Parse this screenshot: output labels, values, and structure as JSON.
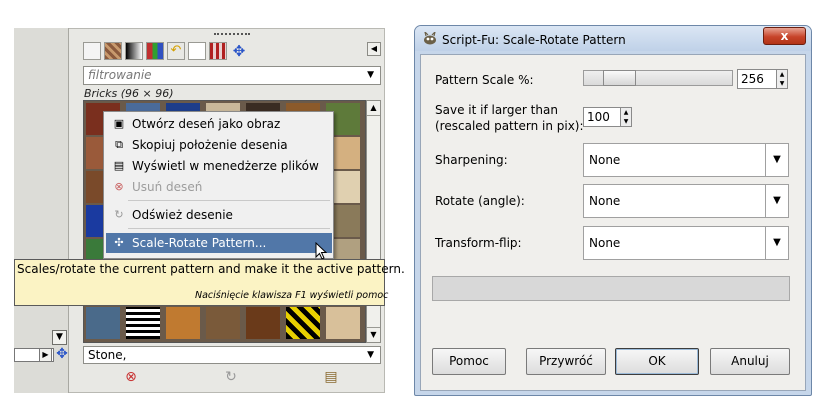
{
  "gimp_dock": {
    "filter_placeholder": "filtrowanie",
    "pattern_label": "Bricks (96 × 96)",
    "bottom_pattern": "Stone,",
    "toolbar_icons": [
      "document-icon",
      "pattern-swatch-icon",
      "gradient-icon",
      "palette-icon",
      "font-icon",
      "white-square-icon",
      "pattern-red-icon",
      "move-icon"
    ]
  },
  "context_menu": {
    "items": [
      {
        "label": "Otwórz deseń jako obraz",
        "icon": "open-icon",
        "enabled": true
      },
      {
        "label": "Skopiuj położenie desenia",
        "icon": "copy-icon",
        "enabled": true
      },
      {
        "label": "Wyświetl w menedżerze plików",
        "icon": "file-manager-icon",
        "enabled": true
      },
      {
        "label": "Usuń deseń",
        "icon": "delete-icon",
        "enabled": false
      },
      {
        "label": "Odśwież desenie",
        "icon": "refresh-icon",
        "enabled": true
      },
      {
        "label": "Scale-Rotate Pattern...",
        "icon": "script-icon",
        "enabled": true,
        "highlighted": true
      }
    ]
  },
  "tooltip": {
    "text": "Scales/rotate the current pattern and make it the active pattern.",
    "help": "Naciśnięcie klawisza F1 wyświetli pomoc"
  },
  "dialog": {
    "title": "Script-Fu: Scale-Rotate Pattern",
    "close_label": "x",
    "pattern_scale_label": "Pattern Scale %:",
    "pattern_scale_value": "256",
    "pattern_scale_slider_fraction": 0.25,
    "save_if_larger_label_1": "Save it if larger than",
    "save_if_larger_label_2": "(rescaled pattern in pix):",
    "save_if_larger_value": "100",
    "sharpening_label": "Sharpening:",
    "sharpening_value": "None",
    "rotate_label": "Rotate (angle):",
    "rotate_value": "None",
    "flip_label": "Transform-flip:",
    "flip_value": "None",
    "buttons": {
      "help": "Pomoc",
      "reset": "Przywróć",
      "ok": "OK",
      "cancel": "Anuluj"
    }
  },
  "colors": {
    "menu_highlight": "#5177a8",
    "tooltip_bg": "#fbf3c4",
    "close_button": "#c7442a"
  }
}
